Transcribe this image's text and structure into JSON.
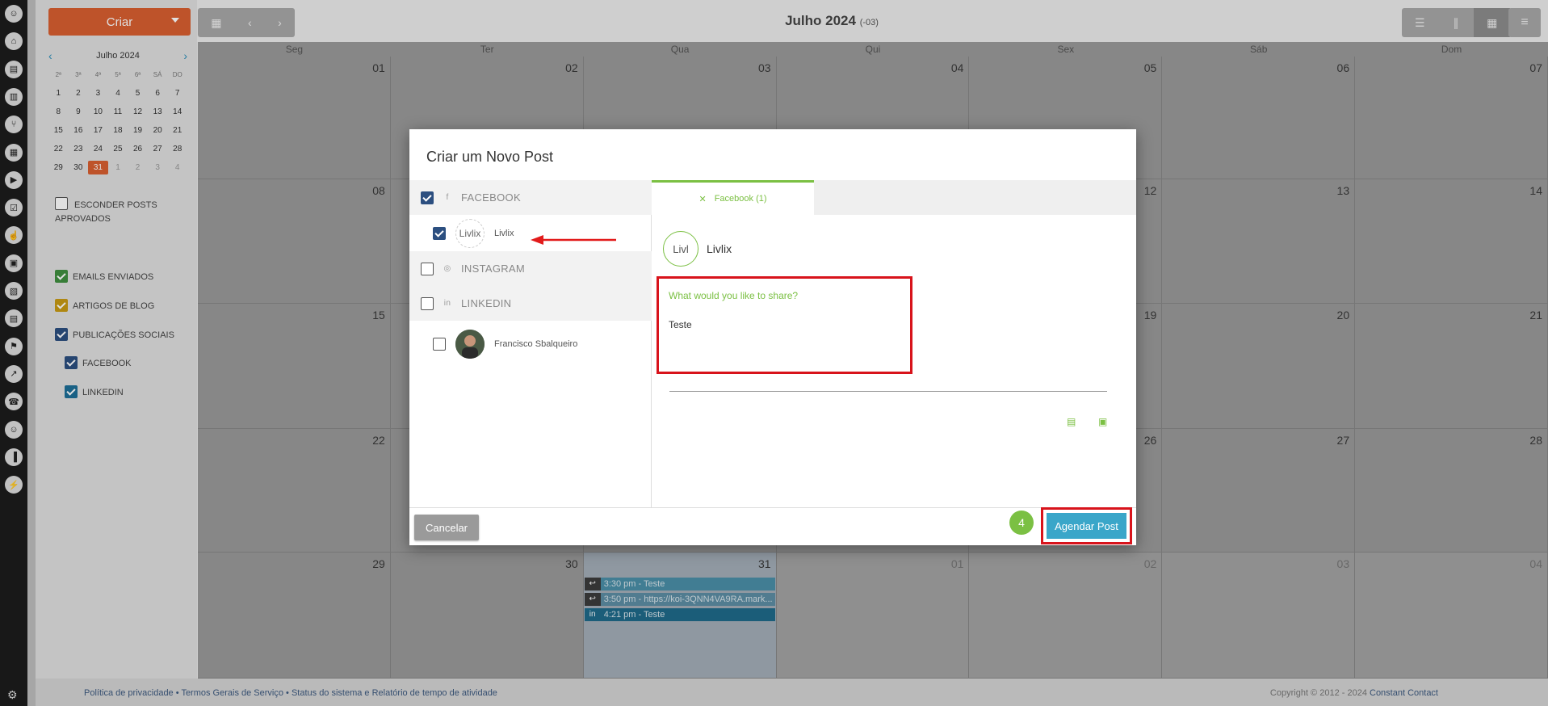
{
  "sidebar": {
    "icons": [
      "user-icon",
      "home-icon",
      "clipboard-icon",
      "book-icon",
      "branch-icon",
      "table-icon",
      "megaphone-icon",
      "checklist-icon",
      "thumbs-up-icon",
      "calendar-icon",
      "image-icon",
      "calendar-2-icon",
      "handshake-icon",
      "chart-icon",
      "headset-icon",
      "user-add-icon",
      "bar-chart-icon",
      "plug-icon"
    ]
  },
  "toolbar": {
    "create_label": "Criar"
  },
  "header": {
    "month": "Julho 2024",
    "tz": "(-03)"
  },
  "mini_calendar": {
    "title": "Julho 2024",
    "weekdays": [
      "2ª",
      "3ª",
      "4ª",
      "5ª",
      "6ª",
      "SÁ",
      "DO"
    ],
    "weeks": [
      [
        "1",
        "2",
        "3",
        "4",
        "5",
        "6",
        "7"
      ],
      [
        "8",
        "9",
        "10",
        "11",
        "12",
        "13",
        "14"
      ],
      [
        "15",
        "16",
        "17",
        "18",
        "19",
        "20",
        "21"
      ],
      [
        "22",
        "23",
        "24",
        "25",
        "26",
        "27",
        "28"
      ],
      [
        "29",
        "30",
        "31",
        "1",
        "2",
        "3",
        "4"
      ]
    ]
  },
  "filters": {
    "hide_approved": "ESCONDER POSTS APROVADOS",
    "emails": "EMAILS ENVIADOS",
    "blog": "ARTIGOS DE BLOG",
    "social": "PUBLICAÇÕES SOCIAIS",
    "facebook": "FACEBOOK",
    "linkedin": "LINKEDIN",
    "colors": {
      "emails": "#3f8f3f",
      "blog": "#c89a14",
      "social": "#2c4f80",
      "facebook": "#2c4f80",
      "linkedin": "#1d6f98"
    }
  },
  "calendar": {
    "day_headers": [
      "Seg",
      "Ter",
      "Qua",
      "Qui",
      "Sex",
      "Sáb",
      "Dom"
    ],
    "weeks": [
      [
        "01",
        "02",
        "03",
        "04",
        "05",
        "06",
        "07"
      ],
      [
        "08",
        "09",
        "10",
        "11",
        "12",
        "13",
        "14"
      ],
      [
        "15",
        "16",
        "17",
        "18",
        "19",
        "20",
        "21"
      ],
      [
        "22",
        "23",
        "24",
        "25",
        "26",
        "27",
        "28"
      ],
      [
        "29",
        "30",
        "31",
        "01",
        "02",
        "03",
        "04"
      ]
    ],
    "events": [
      {
        "text": "3:30 pm - Teste",
        "icon": "reply-icon"
      },
      {
        "text": "3:50 pm - https://koi-3QNN4VA9RA.mark...",
        "icon": "reply-icon"
      },
      {
        "text": "4:21 pm - Teste",
        "icon": "linkedin-icon"
      }
    ]
  },
  "footer": {
    "links": "Política de privacidade • Termos Gerais de Serviço • Status do sistema e Relatório de tempo de atividade",
    "copyright": "Copyright © 2012 - 2024",
    "brand": "Constant Contact"
  },
  "modal": {
    "title": "Criar um Novo Post",
    "networks": {
      "facebook": "FACEBOOK",
      "facebook_account": "Livlix",
      "facebook_avatar_alt": "Livlix",
      "instagram": "INSTAGRAM",
      "linkedin": "LINKEDIN",
      "linkedin_account": "Francisco Sbalqueiro"
    },
    "tab_label": "Facebook (1)",
    "profile_name": "Livlix",
    "profile_avatar_alt": "Livl",
    "composer_placeholder": "What would you like to share?",
    "composer_text": "Teste",
    "cancel_label": "Cancelar",
    "step_number": "4",
    "submit_label": "Agendar Post"
  }
}
